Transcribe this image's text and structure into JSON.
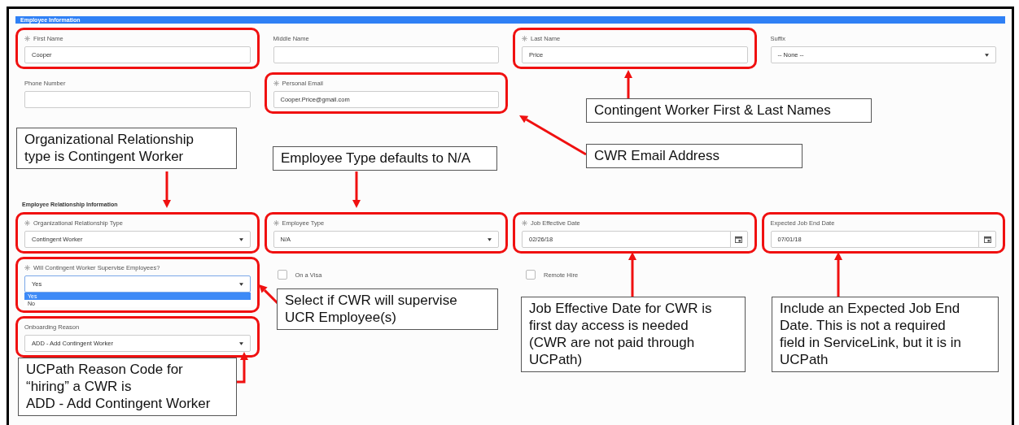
{
  "sections": [
    {
      "title": "Employee Information",
      "kind": "banner",
      "rows": [
        [
          {
            "kind": "text",
            "label": "First Name",
            "required": true,
            "value": "Cooper",
            "highlighted": true
          },
          {
            "kind": "text",
            "label": "Middle Name",
            "required": false,
            "highlighted": false
          },
          {
            "kind": "text",
            "label": "Last Name",
            "required": true,
            "value": "Price",
            "highlighted": true
          },
          {
            "kind": "select",
            "label": "Suffix",
            "required": false,
            "value": "-- None --",
            "highlighted": false
          }
        ],
        [
          {
            "kind": "text",
            "label": "Phone Number",
            "required": false,
            "highlighted": false
          },
          {
            "kind": "text",
            "label": "Personal Email",
            "required": true,
            "value": "Cooper.Price@gmail.com",
            "highlighted": true
          }
        ]
      ]
    },
    {
      "title": "Employee Relationship Information",
      "kind": "heading",
      "rows": [
        [
          {
            "kind": "select",
            "label": "Organizational Relationship Type",
            "required": true,
            "value": "Contingent Worker",
            "highlighted": true
          },
          {
            "kind": "select",
            "label": "Employee Type",
            "required": true,
            "value": "N/A",
            "highlighted": true
          },
          {
            "kind": "date",
            "label": "Job Effective Date",
            "required": true,
            "value": "02/26/18",
            "highlighted": true
          },
          {
            "kind": "date",
            "label": "Expected Job End Date",
            "required": false,
            "value": "07/01/18",
            "highlighted": true
          }
        ],
        [
          {
            "kind": "select",
            "label": "Will Contingent Worker Supervise Employees?",
            "required": true,
            "value": "Yes",
            "highlighted": true,
            "options": [
              {
                "label": "Yes",
                "selected": true
              },
              {
                "label": "No",
                "selected": false
              }
            ]
          },
          {
            "kind": "checkbox",
            "label": "On a Visa",
            "checked": false
          },
          {
            "kind": "checkbox",
            "label": "Remote Hire",
            "checked": false
          }
        ],
        [
          {
            "kind": "select",
            "label": "Onboarding Reason",
            "required": false,
            "value": "ADD - Add Contingent Worker",
            "highlighted": true
          }
        ]
      ]
    }
  ],
  "callouts": [
    {
      "lines": [
        "Contingent Worker First & Last Names"
      ]
    },
    {
      "lines": [
        "Organizational Relationship",
        "type is Contingent Worker"
      ]
    },
    {
      "lines": [
        "Employee Type defaults to N/A"
      ]
    },
    {
      "lines": [
        "CWR Email Address"
      ]
    },
    {
      "lines": [
        "Select if CWR will supervise",
        "UCR Employee(s)"
      ]
    },
    {
      "lines": [
        "Job Effective Date for CWR is",
        "first day access is needed",
        "(CWR are not paid through",
        "UCPath)"
      ]
    },
    {
      "lines": [
        "Include an Expected Job End",
        "Date. This is not a required",
        "field in ServiceLink, but it is in",
        "UCPath"
      ]
    },
    {
      "lines": [
        "UCPath Reason Code for",
        "“hiring” a CWR is",
        "ADD - Add Contingent Worker"
      ]
    }
  ]
}
